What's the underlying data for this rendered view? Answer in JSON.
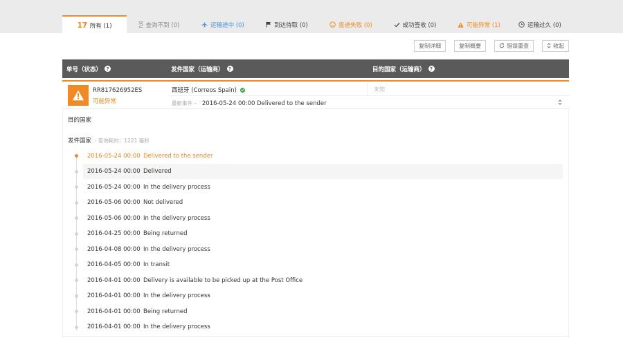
{
  "tabs": [
    {
      "label": "所有 (1)",
      "icon": "17track-logo",
      "state": "active"
    },
    {
      "label": "查询不到 (0)",
      "icon": "hourglass-icon"
    },
    {
      "label": "运输途中 (0)",
      "icon": "plane-icon"
    },
    {
      "label": "到达待取 (0)",
      "icon": "flag-icon"
    },
    {
      "label": "投递失败 (0)",
      "icon": "sad-face-icon"
    },
    {
      "label": "成功签收 (0)",
      "icon": "check-icon"
    },
    {
      "label": "可能异常 (1)",
      "icon": "warning-icon"
    },
    {
      "label": "运输过久 (0)",
      "icon": "clock-icon"
    }
  ],
  "logo_text": "17",
  "toolbar": {
    "copy_detail": "复制详细",
    "copy_summary": "复制概要",
    "retry_errors": "错误重查",
    "collapse": "收起"
  },
  "table_header": {
    "number_status": "单号（状态）",
    "origin_country": "发件国家（运输商）",
    "dest_country": "目的国家（运输商）"
  },
  "shipment": {
    "tracking_number": "RR817626952ES",
    "status": "可能异常",
    "origin_carrier": "西班牙 (Correos Spain)",
    "destination": "未知",
    "latest_label": "最新事件 –",
    "latest_event": "2016-05-24 00:00 Delivered to the sender"
  },
  "detail": {
    "destination_label": "目的国家",
    "origin_label": "发件国家",
    "query_time": "- 查询耗时：1221 毫秒"
  },
  "events": [
    {
      "time": "2016-05-24 00:00",
      "desc": "Delivered to the sender"
    },
    {
      "time": "2016-05-24 00:00",
      "desc": "Delivered"
    },
    {
      "time": "2016-05-24 00:00",
      "desc": "In the delivery process"
    },
    {
      "time": "2016-05-06 00:00",
      "desc": "Not delivered"
    },
    {
      "time": "2016-05-06 00:00",
      "desc": "In the delivery process"
    },
    {
      "time": "2016-04-25 00:00",
      "desc": "Being returned"
    },
    {
      "time": "2016-04-08 00:00",
      "desc": "In the delivery process"
    },
    {
      "time": "2016-04-05 00:00",
      "desc": "In transit"
    },
    {
      "time": "2016-04-01 00:00",
      "desc": "Delivery is available to be picked up at the Post Office"
    },
    {
      "time": "2016-04-01 00:00",
      "desc": "In the delivery process"
    },
    {
      "time": "2016-04-01 00:00",
      "desc": "Being returned"
    },
    {
      "time": "2016-04-01 00:00",
      "desc": "In the delivery process"
    }
  ],
  "colors": {
    "accent": "#f08a24",
    "header_bg": "#5a5a5a",
    "blue": "#4a90d9",
    "ok": "#3aa64a"
  }
}
